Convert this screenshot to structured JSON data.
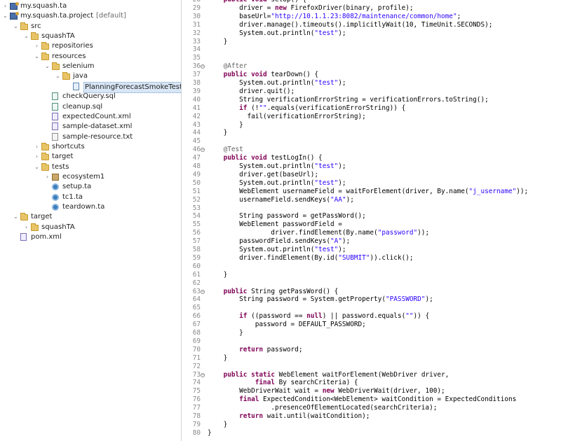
{
  "project_tree": {
    "items": [
      {
        "label": "my.squash.ta",
        "icon": "project-icon",
        "chev": "›",
        "depth": 0
      },
      {
        "label": "my.squash.ta.project",
        "suffix": "[default]",
        "icon": "project-icon",
        "chev": "⌄",
        "depth": 0
      },
      {
        "label": "src",
        "icon": "folder-icon",
        "chev": "⌄",
        "depth": 1
      },
      {
        "label": "squashTA",
        "icon": "folder-icon",
        "chev": "⌄",
        "depth": 2
      },
      {
        "label": "repositories",
        "icon": "folder-icon",
        "chev": "›",
        "depth": 3
      },
      {
        "label": "resources",
        "icon": "folder-icon",
        "chev": "⌄",
        "depth": 3
      },
      {
        "label": "selenium",
        "icon": "folder-icon",
        "chev": "⌄",
        "depth": 4
      },
      {
        "label": "java",
        "icon": "folder-icon",
        "chev": "⌄",
        "depth": 5
      },
      {
        "label": "PlanningForecastSmokeTest.jav",
        "icon": "java-file-icon",
        "chev": "",
        "depth": 6,
        "selected": true
      },
      {
        "label": "checkQuery.sql",
        "icon": "sql-file-icon",
        "chev": "",
        "depth": 4
      },
      {
        "label": "cleanup.sql",
        "icon": "sql-file-icon",
        "chev": "",
        "depth": 4
      },
      {
        "label": "expectedCount.xml",
        "icon": "xml-file-icon",
        "chev": "",
        "depth": 4
      },
      {
        "label": "sample-dataset.xml",
        "icon": "xml-file-icon",
        "chev": "",
        "depth": 4
      },
      {
        "label": "sample-resource.txt",
        "icon": "text-file-icon",
        "chev": "",
        "depth": 4
      },
      {
        "label": "shortcuts",
        "icon": "folder-icon",
        "chev": "›",
        "depth": 3
      },
      {
        "label": "target",
        "icon": "folder-icon",
        "chev": "›",
        "depth": 3
      },
      {
        "label": "tests",
        "icon": "folder-icon",
        "chev": "⌄",
        "depth": 3
      },
      {
        "label": "ecosystem1",
        "icon": "package-icon",
        "chev": "›",
        "depth": 4
      },
      {
        "label": "setup.ta",
        "icon": "ta-file-icon",
        "chev": "",
        "depth": 4
      },
      {
        "label": "tc1.ta",
        "icon": "ta-file-icon",
        "chev": "",
        "depth": 4
      },
      {
        "label": "teardown.ta",
        "icon": "ta-file-icon",
        "chev": "",
        "depth": 4
      },
      {
        "label": "target",
        "icon": "folder-icon",
        "chev": "⌄",
        "depth": 1
      },
      {
        "label": "squashTA",
        "icon": "folder-icon",
        "chev": "›",
        "depth": 2
      },
      {
        "label": "pom.xml",
        "icon": "xml-file-icon",
        "chev": "",
        "depth": 1
      }
    ]
  },
  "editor": {
    "lines": [
      {
        "n": "28",
        "fold": false,
        "code": "    public void setUp() {"
      },
      {
        "n": "29",
        "fold": false,
        "code": "        driver = new FirefoxDriver(binary, profile);"
      },
      {
        "n": "30",
        "fold": false,
        "code": "        baseUrl=\"http://10.1.1.23:8082/maintenance/common/home\";"
      },
      {
        "n": "31",
        "fold": false,
        "code": "        driver.manage().timeouts().implicitlyWait(10, TimeUnit.SECONDS);"
      },
      {
        "n": "32",
        "fold": false,
        "code": "        System.out.println(\"test\");"
      },
      {
        "n": "33",
        "fold": false,
        "code": "    }"
      },
      {
        "n": "34",
        "fold": false,
        "code": ""
      },
      {
        "n": "35",
        "fold": false,
        "code": ""
      },
      {
        "n": "36",
        "fold": true,
        "code": "    @After"
      },
      {
        "n": "37",
        "fold": false,
        "code": "    public void tearDown() {"
      },
      {
        "n": "38",
        "fold": false,
        "code": "        System.out.println(\"test\");"
      },
      {
        "n": "39",
        "fold": false,
        "code": "        driver.quit();"
      },
      {
        "n": "40",
        "fold": false,
        "code": "        String verificationErrorString = verificationErrors.toString();"
      },
      {
        "n": "41",
        "fold": false,
        "code": "        if (!\"\".equals(verificationErrorString)) {"
      },
      {
        "n": "42",
        "fold": false,
        "code": "          fail(verificationErrorString);"
      },
      {
        "n": "43",
        "fold": false,
        "code": "        }"
      },
      {
        "n": "44",
        "fold": false,
        "code": "    }"
      },
      {
        "n": "45",
        "fold": false,
        "code": ""
      },
      {
        "n": "46",
        "fold": true,
        "code": "    @Test"
      },
      {
        "n": "47",
        "fold": false,
        "code": "    public void testLogIn() {"
      },
      {
        "n": "48",
        "fold": false,
        "code": "        System.out.println(\"test\");"
      },
      {
        "n": "49",
        "fold": false,
        "code": "        driver.get(baseUrl);"
      },
      {
        "n": "50",
        "fold": false,
        "code": "        System.out.println(\"test\");"
      },
      {
        "n": "51",
        "fold": false,
        "code": "        WebElement usernameField = waitForElement(driver, By.name(\"j_username\"));"
      },
      {
        "n": "52",
        "fold": false,
        "code": "        usernameField.sendKeys(\"AA\");"
      },
      {
        "n": "53",
        "fold": false,
        "code": ""
      },
      {
        "n": "54",
        "fold": false,
        "code": "        String password = getPassWord();"
      },
      {
        "n": "55",
        "fold": false,
        "code": "        WebElement passwordField ="
      },
      {
        "n": "56",
        "fold": false,
        "code": "                driver.findElement(By.name(\"password\"));"
      },
      {
        "n": "57",
        "fold": false,
        "code": "        passwordField.sendKeys(\"A\");"
      },
      {
        "n": "58",
        "fold": false,
        "code": "        System.out.println(\"test\");"
      },
      {
        "n": "59",
        "fold": false,
        "code": "        driver.findElement(By.id(\"SUBMIT\")).click();"
      },
      {
        "n": "60",
        "fold": false,
        "code": ""
      },
      {
        "n": "61",
        "fold": false,
        "code": "    }"
      },
      {
        "n": "62",
        "fold": false,
        "code": ""
      },
      {
        "n": "63",
        "fold": true,
        "code": "    public String getPassWord() {"
      },
      {
        "n": "64",
        "fold": false,
        "code": "        String password = System.getProperty(\"PASSWORD\");"
      },
      {
        "n": "65",
        "fold": false,
        "code": ""
      },
      {
        "n": "66",
        "fold": false,
        "code": "        if ((password == null) || password.equals(\"\")) {"
      },
      {
        "n": "67",
        "fold": false,
        "code": "            password = DEFAULT_PASSWORD;"
      },
      {
        "n": "68",
        "fold": false,
        "code": "        }"
      },
      {
        "n": "69",
        "fold": false,
        "code": ""
      },
      {
        "n": "70",
        "fold": false,
        "code": "        return password;"
      },
      {
        "n": "71",
        "fold": false,
        "code": "    }"
      },
      {
        "n": "72",
        "fold": false,
        "code": ""
      },
      {
        "n": "73",
        "fold": true,
        "code": "    public static WebElement waitForElement(WebDriver driver,"
      },
      {
        "n": "74",
        "fold": false,
        "code": "            final By searchCriteria) {"
      },
      {
        "n": "75",
        "fold": false,
        "code": "        WebDriverWait wait = new WebDriverWait(driver, 100);"
      },
      {
        "n": "76",
        "fold": false,
        "code": "        final ExpectedCondition<WebElement> waitCondition = ExpectedConditions"
      },
      {
        "n": "77",
        "fold": false,
        "code": "                .presenceOfElementLocated(searchCriteria);"
      },
      {
        "n": "78",
        "fold": false,
        "code": "        return wait.until(waitCondition);"
      },
      {
        "n": "79",
        "fold": false,
        "code": "    }"
      },
      {
        "n": "80",
        "fold": false,
        "code": "}"
      }
    ]
  }
}
